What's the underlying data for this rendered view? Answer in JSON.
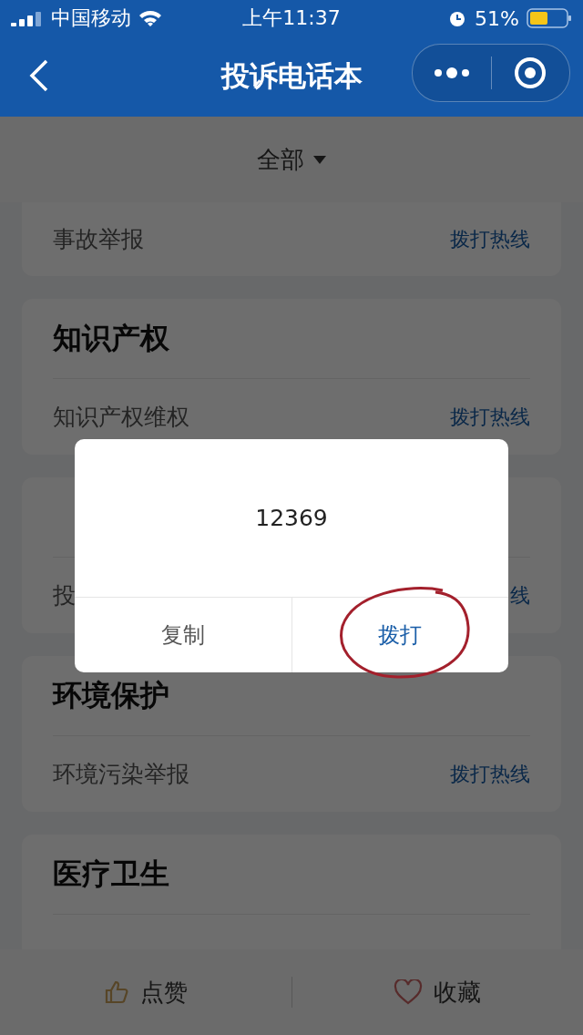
{
  "status_bar": {
    "carrier": "中国移动",
    "time": "上午11:37",
    "battery": "51%"
  },
  "nav": {
    "title": "投诉电话本"
  },
  "filter": {
    "label": "全部"
  },
  "top_card": {
    "items": [
      {
        "name": "事故举报",
        "action": "拨打热线"
      }
    ]
  },
  "categories": [
    {
      "title": "知识产权",
      "items": [
        {
          "name": "知识产权维权",
          "action": "拨打热线"
        }
      ]
    },
    {
      "items": [
        {
          "name": "投",
          "action": "线"
        }
      ]
    },
    {
      "title": "环境保护",
      "items": [
        {
          "name": "环境污染举报",
          "action": "拨打热线"
        }
      ]
    },
    {
      "title": "医疗卫生"
    }
  ],
  "dialog": {
    "number": "12369",
    "buttons": [
      {
        "label": "复制",
        "kind": "cancel"
      },
      {
        "label": "拨打",
        "kind": "confirm"
      }
    ]
  },
  "bottom_bar": [
    {
      "label": "点赞",
      "kind": "like"
    },
    {
      "label": "收藏",
      "kind": "favorite"
    }
  ]
}
